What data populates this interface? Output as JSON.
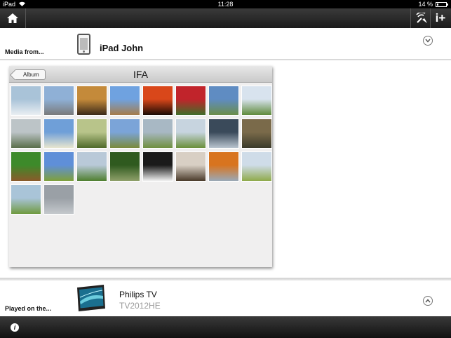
{
  "status_bar": {
    "carrier": "iPad",
    "time": "11:28",
    "battery": "14 %"
  },
  "toolbar": {
    "home_icon": "home-icon",
    "connect_icon": "connection-icon",
    "info_add_label": "i+"
  },
  "media_from": {
    "label": "Media from...",
    "device_name": "iPad John",
    "device_icon": "tablet-icon",
    "toggle_icon": "chevron-down-icon"
  },
  "album": {
    "back_label": "Album",
    "title": "IFA",
    "thumbnails": [
      {
        "colors": [
          "#a9c3d8",
          "#e9eef2"
        ]
      },
      {
        "colors": [
          "#8fb0d6",
          "#7a7a7a"
        ]
      },
      {
        "colors": [
          "#c48a3a",
          "#3b2a1a"
        ]
      },
      {
        "colors": [
          "#6fa2e0",
          "#a67c4a"
        ]
      },
      {
        "colors": [
          "#d9471a",
          "#1a0a04"
        ]
      },
      {
        "colors": [
          "#c1242b",
          "#3f6e2a"
        ]
      },
      {
        "colors": [
          "#5f8cc2",
          "#6b8e4a"
        ]
      },
      {
        "colors": [
          "#d8e3ee",
          "#5f8a3a"
        ]
      },
      {
        "colors": [
          "#bcc4c7",
          "#5a6e4a"
        ]
      },
      {
        "colors": [
          "#6f9fd8",
          "#e8e6cf"
        ]
      },
      {
        "colors": [
          "#b8c48a",
          "#4f6a2a"
        ]
      },
      {
        "colors": [
          "#7ba4d8",
          "#7a8a3a"
        ]
      },
      {
        "colors": [
          "#a8b8c4",
          "#6f8f3f"
        ]
      },
      {
        "colors": [
          "#c7d4df",
          "#6a8f3a"
        ]
      },
      {
        "colors": [
          "#3a4a5a",
          "#b9c4cf"
        ]
      },
      {
        "colors": [
          "#7a6a4a",
          "#3a3a2a"
        ]
      },
      {
        "colors": [
          "#3d8a2a",
          "#8a5a2a"
        ]
      },
      {
        "colors": [
          "#5f8fd8",
          "#7fa03a"
        ]
      },
      {
        "colors": [
          "#b9c9d8",
          "#4f7f2f"
        ]
      },
      {
        "colors": [
          "#2f5a1f",
          "#8fa06a"
        ]
      },
      {
        "colors": [
          "#1a1a1a",
          "#f1f1f1"
        ]
      },
      {
        "colors": [
          "#d8cfc4",
          "#4a3a2a"
        ]
      },
      {
        "colors": [
          "#d8741f",
          "#9aa9b8"
        ]
      },
      {
        "colors": [
          "#cfdce8",
          "#8faa4a"
        ]
      },
      {
        "colors": [
          "#a9c4d8",
          "#6f9a3f"
        ]
      },
      {
        "colors": [
          "#9aa0a6",
          "#c4c8cc"
        ]
      }
    ]
  },
  "played_on": {
    "label": "Played on the...",
    "tv_name": "Philips TV",
    "tv_model": "TV2012HE",
    "toggle_icon": "chevron-up-icon"
  },
  "bottom_bar": {
    "info_label": "i"
  }
}
